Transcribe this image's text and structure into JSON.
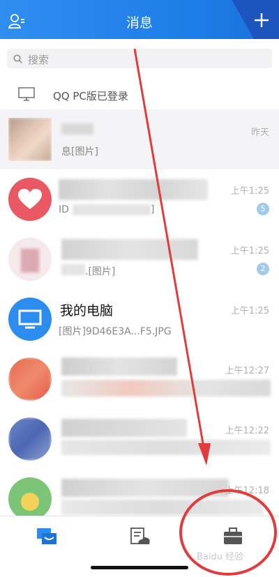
{
  "header": {
    "title": "消息",
    "contacts_icon": "contacts-icon",
    "plus_icon": "plus-icon"
  },
  "search": {
    "placeholder": "搜索",
    "icon": "search-icon"
  },
  "pc_login": {
    "label": "QQ PC版已登录",
    "icon": "monitor-icon"
  },
  "conversations": [
    {
      "name": "",
      "message": "息[图片]",
      "time": "昨天",
      "badge": ""
    },
    {
      "name": "",
      "message": "ID",
      "message_tail": "]",
      "time": "上午1:25",
      "badge": "5"
    },
    {
      "name": "",
      "message": ".[图片]",
      "time": "上午1:25",
      "badge": "2"
    },
    {
      "name": "我的电脑",
      "message": "[图片]9D46E3A...F5.JPG",
      "time": "上午1:25",
      "badge": ""
    },
    {
      "name": "",
      "message": "",
      "time": "上午12:27",
      "badge": ""
    },
    {
      "name": "",
      "message": "",
      "time": "上午12:22",
      "badge": ""
    },
    {
      "name": "",
      "message": "",
      "time": "上午12:18",
      "badge": ""
    }
  ],
  "tabbar": {
    "tabs": [
      {
        "icon": "messages-icon",
        "active": true
      },
      {
        "icon": "contacts-cloud-icon",
        "active": false
      },
      {
        "icon": "briefcase-icon",
        "active": false
      }
    ]
  },
  "watermark": "Baidu 经验",
  "colors": {
    "header": "#1d7de8",
    "accent": "#e23b3b",
    "badge": "#9fcbee"
  }
}
